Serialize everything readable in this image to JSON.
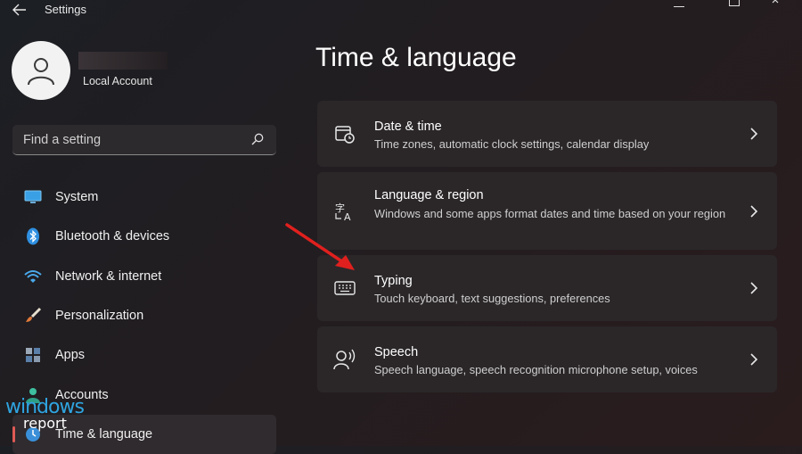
{
  "window": {
    "title": "Settings"
  },
  "profile": {
    "account_type": "Local Account"
  },
  "search": {
    "placeholder": "Find a setting"
  },
  "sidebar": {
    "items": [
      {
        "label": "System",
        "icon": "monitor-icon"
      },
      {
        "label": "Bluetooth & devices",
        "icon": "bluetooth-icon"
      },
      {
        "label": "Network & internet",
        "icon": "wifi-icon"
      },
      {
        "label": "Personalization",
        "icon": "brush-icon"
      },
      {
        "label": "Apps",
        "icon": "apps-icon"
      },
      {
        "label": "Accounts",
        "icon": "person-icon"
      },
      {
        "label": "Time & language",
        "icon": "clock-globe-icon",
        "active": true
      }
    ]
  },
  "main": {
    "title": "Time & language",
    "cards": [
      {
        "title": "Date & time",
        "description": "Time zones, automatic clock settings, calendar display",
        "icon": "calendar-clock-icon"
      },
      {
        "title": "Language & region",
        "description": "Windows and some apps format dates and time based on your region",
        "icon": "language-icon"
      },
      {
        "title": "Typing",
        "description": "Touch keyboard, text suggestions, preferences",
        "icon": "keyboard-icon"
      },
      {
        "title": "Speech",
        "description": "Speech language, speech recognition microphone setup, voices",
        "icon": "speech-icon"
      }
    ]
  },
  "watermark": {
    "line1": "windows",
    "line2": "report"
  },
  "colors": {
    "accent": "#e05a55",
    "card_bg": "#2b2729",
    "annotation_arrow": "#e0201e"
  }
}
